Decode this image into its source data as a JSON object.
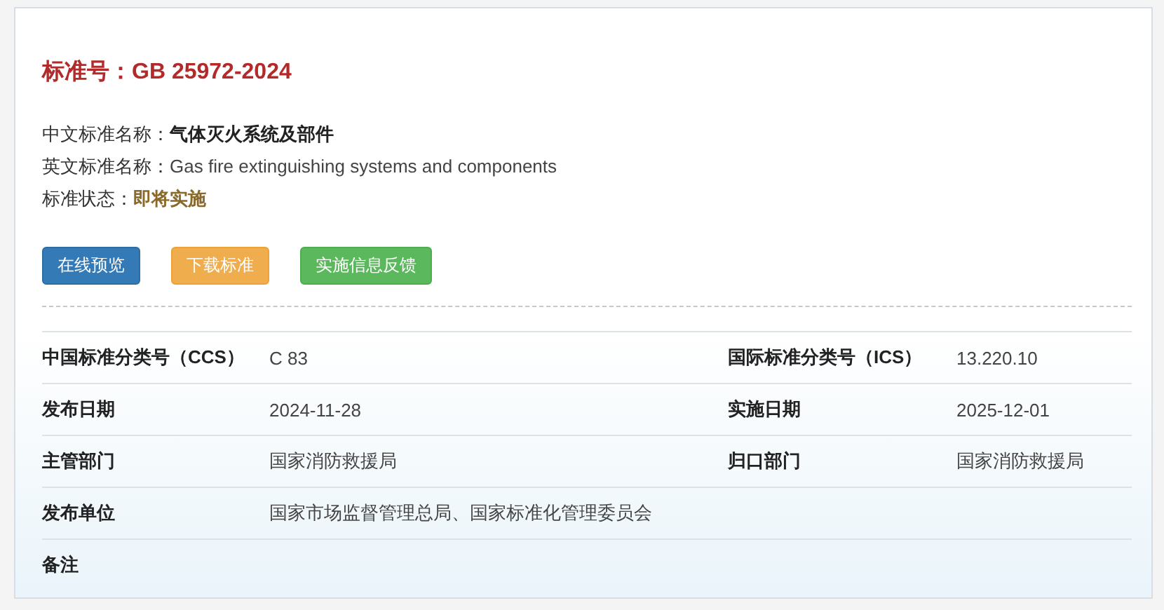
{
  "title": {
    "label": "标准号：",
    "value": "GB 25972-2024"
  },
  "fields": [
    {
      "label": "中文标准名称：",
      "value": "气体灭火系统及部件",
      "kind": "bold"
    },
    {
      "label": "英文标准名称：",
      "value": "Gas fire extinguishing systems and components",
      "kind": "plain"
    },
    {
      "label": "标准状态：",
      "value": "即将实施",
      "kind": "status"
    }
  ],
  "buttons": [
    {
      "label": "在线预览",
      "kind": "primary"
    },
    {
      "label": "下载标准",
      "kind": "warning"
    },
    {
      "label": "实施信息反馈",
      "kind": "success"
    }
  ],
  "table": {
    "rows": [
      [
        {
          "label": "中国标准分类号（CCS）",
          "value": "C 83"
        },
        {
          "label": "国际标准分类号（ICS）",
          "value": "13.220.10"
        }
      ],
      [
        {
          "label": "发布日期",
          "value": "2024-11-28"
        },
        {
          "label": "实施日期",
          "value": "2025-12-01"
        }
      ],
      [
        {
          "label": "主管部门",
          "value": "国家消防救援局"
        },
        {
          "label": "归口部门",
          "value": "国家消防救援局"
        }
      ],
      [
        {
          "label": "发布单位",
          "value": "国家市场监督管理总局、国家标准化管理委员会"
        }
      ],
      [
        {
          "label": "备注"
        }
      ]
    ]
  }
}
